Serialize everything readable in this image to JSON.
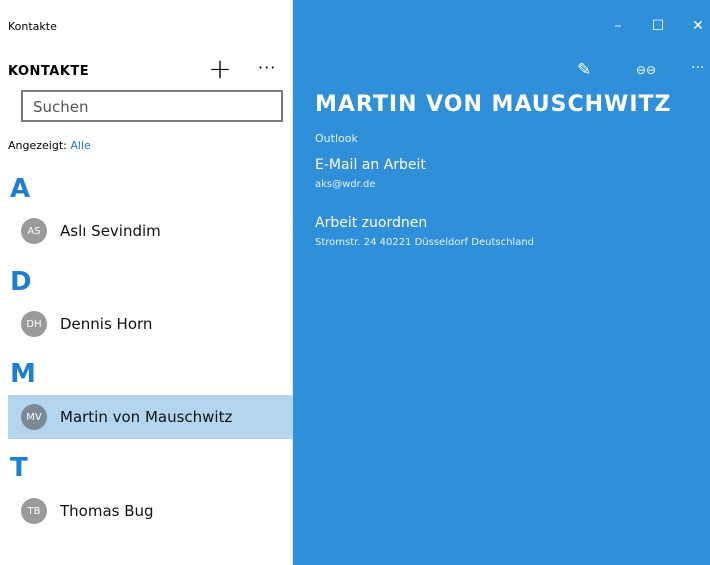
{
  "app": {
    "title": "Kontakte"
  },
  "list": {
    "heading": "KONTAKTE",
    "add_icon": "plus-icon",
    "more_icon": "more-icon",
    "more_label": "···",
    "add_label": "+",
    "search_placeholder": "Suchen",
    "filter_label": "Angezeigt:",
    "filter_value": "Alle",
    "groups": [
      {
        "letter": "A",
        "contacts": [
          {
            "initials": "AS",
            "name": "Aslı Sevindim"
          }
        ]
      },
      {
        "letter": "D",
        "contacts": [
          {
            "initials": "DH",
            "name": "Dennis Horn"
          }
        ]
      },
      {
        "letter": "M",
        "contacts": [
          {
            "initials": "MV",
            "name": "Martin von Mauschwitz",
            "selected": true
          }
        ]
      },
      {
        "letter": "T",
        "contacts": [
          {
            "initials": "TB",
            "name": "Thomas Bug"
          }
        ]
      }
    ]
  },
  "window_controls": {
    "minimize": "–",
    "maximize": "☐",
    "close": "✕"
  },
  "detail": {
    "name": "MARTIN VON MAUSCHWITZ",
    "source": "Outlook",
    "email_label": "E-Mail an Arbeit",
    "email_value": "aks@wdr.de",
    "address_label": "Arbeit zuordnen",
    "address_value": "Stromstr. 24 40221 Düsseldorf Deutschland",
    "edit_label": "✎",
    "link_label": "⊖⊖",
    "more_label": "···"
  },
  "colors": {
    "accent": "#1c7fd1",
    "detail_bg": "#2f8fd8",
    "selection": "#b3d6ee"
  }
}
